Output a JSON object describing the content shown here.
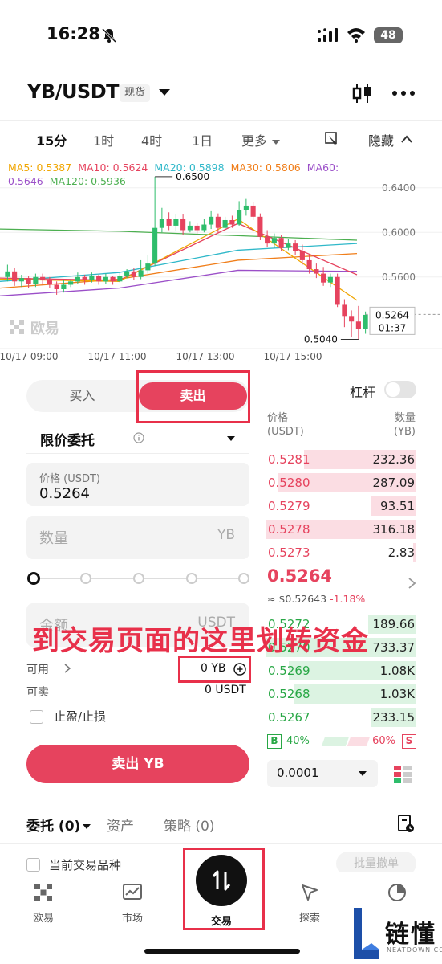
{
  "status_bar": {
    "time": "16:28",
    "battery": "48"
  },
  "header": {
    "pair": "YB/USDT",
    "badge": "现货"
  },
  "timeframes": [
    "15分",
    "1时",
    "4时",
    "1日",
    "更多"
  ],
  "timeframe_active": "15分",
  "chart_controls": {
    "hide_label": "隐藏"
  },
  "ma_legend": [
    {
      "label": "MA5: 0.5387",
      "color": "#f0a500"
    },
    {
      "label": "MA10: 0.5624",
      "color": "#e6435e"
    },
    {
      "label": "MA20: 0.5898",
      "color": "#2fb8c9"
    },
    {
      "label": "MA30: 0.5806",
      "color": "#f07e1a"
    },
    {
      "label": "MA60:",
      "color": "#9b4fc8"
    },
    {
      "label": "0.5646",
      "color": "#9b4fc8"
    },
    {
      "label": "MA120: 0.5936",
      "color": "#4caf50"
    }
  ],
  "chart_data": {
    "type": "candlestick",
    "y_ticks": [
      "0.6400",
      "0.6000",
      "0.5600"
    ],
    "x_ticks": [
      "10/17 09:00",
      "10/17 11:00",
      "10/17 13:00",
      "10/17 15:00"
    ],
    "high_label": "0.6500",
    "low_label": "0.5040",
    "current_price": "0.5264",
    "countdown": "01:37",
    "watermark": "欧易",
    "colors": {
      "up": "#2ebd6b",
      "down": "#e6435e"
    },
    "ylim": [
      0.5,
      0.66
    ],
    "candles": [
      [
        0.56,
        0.565,
        0.571,
        0.556
      ],
      [
        0.565,
        0.556,
        0.568,
        0.552
      ],
      [
        0.556,
        0.559,
        0.562,
        0.551
      ],
      [
        0.559,
        0.554,
        0.561,
        0.55
      ],
      [
        0.554,
        0.56,
        0.563,
        0.551
      ],
      [
        0.56,
        0.557,
        0.563,
        0.553
      ],
      [
        0.557,
        0.553,
        0.56,
        0.55
      ],
      [
        0.553,
        0.549,
        0.556,
        0.544
      ],
      [
        0.549,
        0.553,
        0.557,
        0.546
      ],
      [
        0.553,
        0.556,
        0.558,
        0.551
      ],
      [
        0.556,
        0.56,
        0.564,
        0.554
      ],
      [
        0.56,
        0.557,
        0.562,
        0.553
      ],
      [
        0.557,
        0.561,
        0.564,
        0.555
      ],
      [
        0.561,
        0.556,
        0.562,
        0.553
      ],
      [
        0.556,
        0.56,
        0.563,
        0.554
      ],
      [
        0.56,
        0.556,
        0.561,
        0.553
      ],
      [
        0.556,
        0.561,
        0.564,
        0.555
      ],
      [
        0.561,
        0.565,
        0.567,
        0.559
      ],
      [
        0.565,
        0.56,
        0.568,
        0.557
      ],
      [
        0.56,
        0.566,
        0.575,
        0.558
      ],
      [
        0.566,
        0.572,
        0.58,
        0.563
      ],
      [
        0.572,
        0.604,
        0.65,
        0.57
      ],
      [
        0.604,
        0.612,
        0.622,
        0.6
      ],
      [
        0.612,
        0.606,
        0.618,
        0.602
      ],
      [
        0.606,
        0.612,
        0.616,
        0.601
      ],
      [
        0.612,
        0.602,
        0.616,
        0.598
      ],
      [
        0.602,
        0.606,
        0.61,
        0.6
      ],
      [
        0.606,
        0.602,
        0.608,
        0.598
      ],
      [
        0.602,
        0.607,
        0.612,
        0.6
      ],
      [
        0.607,
        0.614,
        0.619,
        0.603
      ],
      [
        0.614,
        0.604,
        0.617,
        0.6
      ],
      [
        0.604,
        0.611,
        0.614,
        0.602
      ],
      [
        0.611,
        0.607,
        0.615,
        0.604
      ],
      [
        0.607,
        0.62,
        0.628,
        0.606
      ],
      [
        0.62,
        0.624,
        0.63,
        0.615
      ],
      [
        0.624,
        0.614,
        0.627,
        0.611
      ],
      [
        0.614,
        0.596,
        0.617,
        0.593
      ],
      [
        0.596,
        0.59,
        0.602,
        0.587
      ],
      [
        0.59,
        0.595,
        0.599,
        0.586
      ],
      [
        0.595,
        0.586,
        0.598,
        0.583
      ],
      [
        0.586,
        0.59,
        0.594,
        0.584
      ],
      [
        0.59,
        0.583,
        0.593,
        0.58
      ],
      [
        0.583,
        0.575,
        0.589,
        0.571
      ],
      [
        0.575,
        0.567,
        0.58,
        0.563
      ],
      [
        0.567,
        0.563,
        0.572,
        0.559
      ],
      [
        0.563,
        0.555,
        0.569,
        0.552
      ],
      [
        0.555,
        0.56,
        0.563,
        0.551
      ],
      [
        0.56,
        0.535,
        0.563,
        0.533
      ],
      [
        0.535,
        0.525,
        0.54,
        0.515
      ],
      [
        0.525,
        0.52,
        0.53,
        0.506
      ],
      [
        0.52,
        0.513,
        0.534,
        0.504
      ],
      [
        0.513,
        0.526,
        0.529,
        0.509
      ]
    ],
    "ma_series": [
      {
        "name": "MA120",
        "color": "#4caf50",
        "values": [
          0.603,
          0.601,
          0.597,
          0.593
        ]
      },
      {
        "name": "MA20",
        "color": "#2fb8c9",
        "values": [
          0.556,
          0.564,
          0.584,
          0.59
        ]
      },
      {
        "name": "MA30",
        "color": "#f07e1a",
        "values": [
          0.55,
          0.558,
          0.575,
          0.581
        ]
      },
      {
        "name": "MA60",
        "color": "#9b4fc8",
        "values": [
          0.543,
          0.55,
          0.566,
          0.565
        ]
      },
      {
        "name": "MA10",
        "color": "#e6435e",
        "values": [
          0.559,
          0.557,
          0.608,
          0.562
        ]
      },
      {
        "name": "MA5",
        "color": "#f0a500",
        "values": [
          0.558,
          0.556,
          0.612,
          0.539
        ]
      }
    ]
  },
  "order_form": {
    "buy_label": "买入",
    "sell_label": "卖出",
    "order_type": "限价委托",
    "price_label": "价格 (USDT)",
    "price_value": "0.5264",
    "qty_placeholder": "数量",
    "qty_unit": "YB",
    "amount_placeholder": "金额",
    "amount_unit": "USDT",
    "available_label": "可用",
    "available_value": "0 YB",
    "sellable_label": "可卖",
    "sellable_value": "0 USDT",
    "tp_sl_label": "止盈/止损",
    "submit_label": "卖出 YB"
  },
  "annotation": "到交易页面的这里划转资金",
  "order_book": {
    "leverage_label": "杠杆",
    "price_header": "价格",
    "price_unit": "(USDT)",
    "qty_header": "数量",
    "qty_unit": "(YB)",
    "asks": [
      {
        "price": "0.5281",
        "qty": "232.36",
        "depth": 0.75
      },
      {
        "price": "0.5280",
        "qty": "287.09",
        "depth": 0.92
      },
      {
        "price": "0.5279",
        "qty": "93.51",
        "depth": 0.3
      },
      {
        "price": "0.5278",
        "qty": "316.18",
        "depth": 1.0
      },
      {
        "price": "0.5273",
        "qty": "2.83",
        "depth": 0.02
      }
    ],
    "last_price": "0.5264",
    "last_usd": "≈ $0.52643",
    "last_change": "-1.18%",
    "bids": [
      {
        "price": "0.5272",
        "qty": "189.66",
        "depth": 0.32
      },
      {
        "price": "0.5270",
        "qty": "733.37",
        "depth": 1.0
      },
      {
        "price": "0.5269",
        "qty": "1.08K",
        "depth": 0.85
      },
      {
        "price": "0.5268",
        "qty": "1.03K",
        "depth": 0.82
      },
      {
        "price": "0.5267",
        "qty": "233.15",
        "depth": 0.3
      }
    ],
    "buy_ratio": "40%",
    "sell_ratio": "60%",
    "b_label": "B",
    "s_label": "S",
    "precision": "0.0001"
  },
  "orders": {
    "tab_orders": "委托 (0)",
    "tab_assets": "资产",
    "tab_strategy": "策略 (0)",
    "current_pair_label": "当前交易品种",
    "batch_cancel": "批量撤单"
  },
  "nav": {
    "home": "欧易",
    "market": "市场",
    "trade": "交易",
    "explore": "探索"
  },
  "watermark_brand": {
    "name": "链懂",
    "sub": "NEATDOWN.COM"
  }
}
